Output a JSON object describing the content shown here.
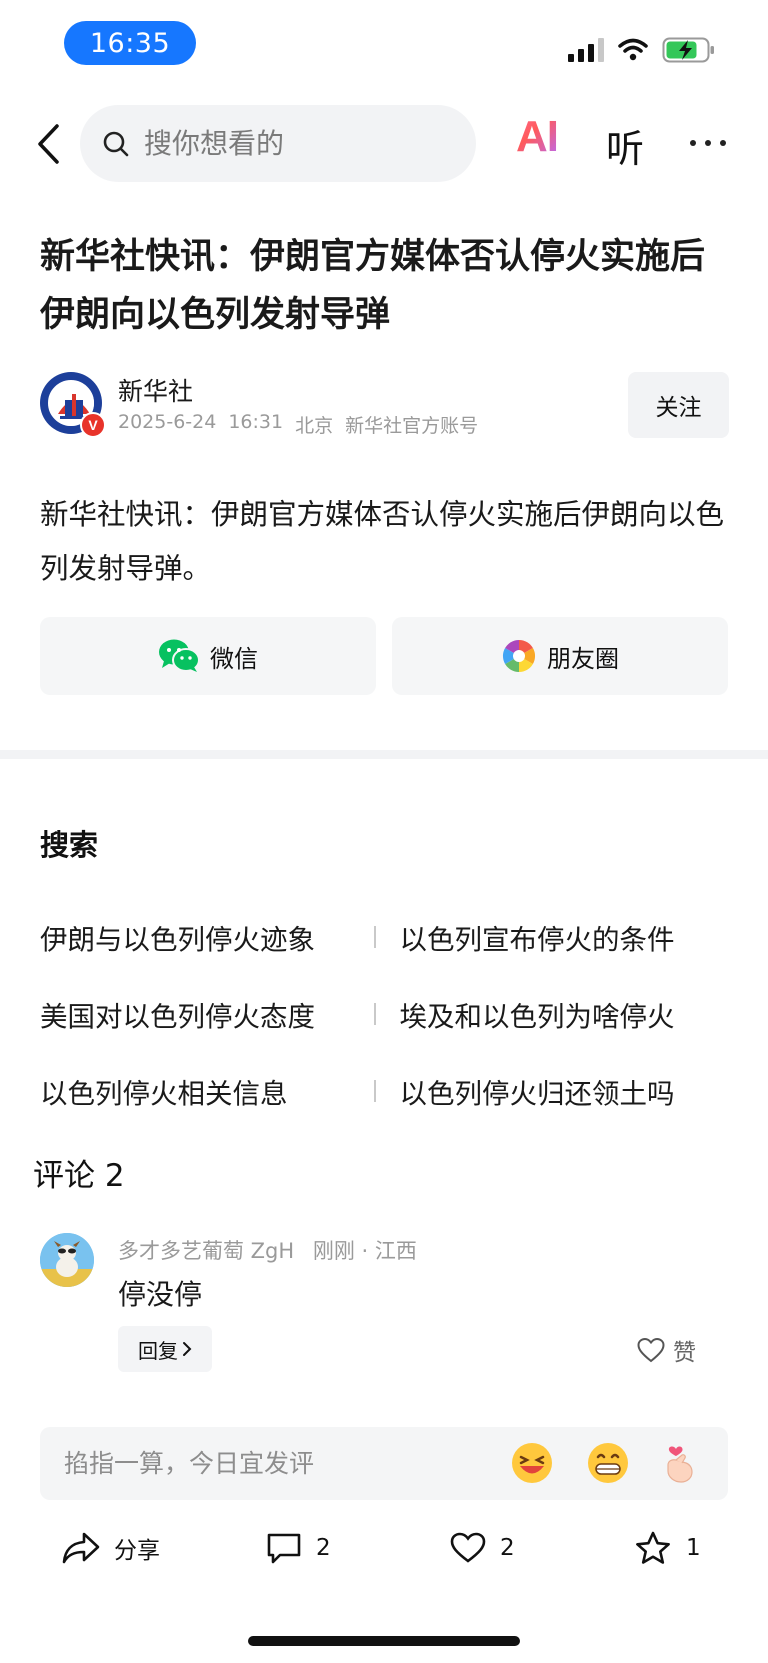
{
  "status_bar": {
    "time": "16:35"
  },
  "nav": {
    "search_placeholder": "搜你想看的",
    "ai_label": "AI",
    "listen_label": "听"
  },
  "article": {
    "title": "新华社快讯：伊朗官方媒体否认停火实施后伊朗向以色列发射导弹",
    "author": "新华社",
    "date": "2025-6-24",
    "time": "16:31",
    "location": "北京",
    "account_type": "新华社官方账号",
    "follow_label": "关注",
    "body": "新华社快讯：伊朗官方媒体否认停火实施后伊朗向以色列发射导弹。"
  },
  "share": {
    "wechat_label": "微信",
    "moments_label": "朋友圈"
  },
  "related_search": {
    "title": "搜索",
    "items": [
      "伊朗与以色列停火迹象",
      "以色列宣布停火的条件",
      "美国对以色列停火态度",
      "埃及和以色列为啥停火",
      "以色列停火相关信息",
      "以色列停火归还领土吗"
    ]
  },
  "comments": {
    "title": "评论 2",
    "list": [
      {
        "user": "多才多艺葡萄 ZgH",
        "meta": "刚刚 · 江西",
        "text": "停没停",
        "reply_label": "回复",
        "like_label": "赞"
      }
    ],
    "input_placeholder": "掐指一算，今日宜发评"
  },
  "bottom_bar": {
    "share_label": "分享",
    "comment_count": "2",
    "like_count": "2",
    "favorite_count": "1"
  },
  "colors": {
    "time_pill": "#1677ff",
    "battery": "#34c759",
    "verified_badge": "#e8332a",
    "wechat_green": "#07c160"
  }
}
